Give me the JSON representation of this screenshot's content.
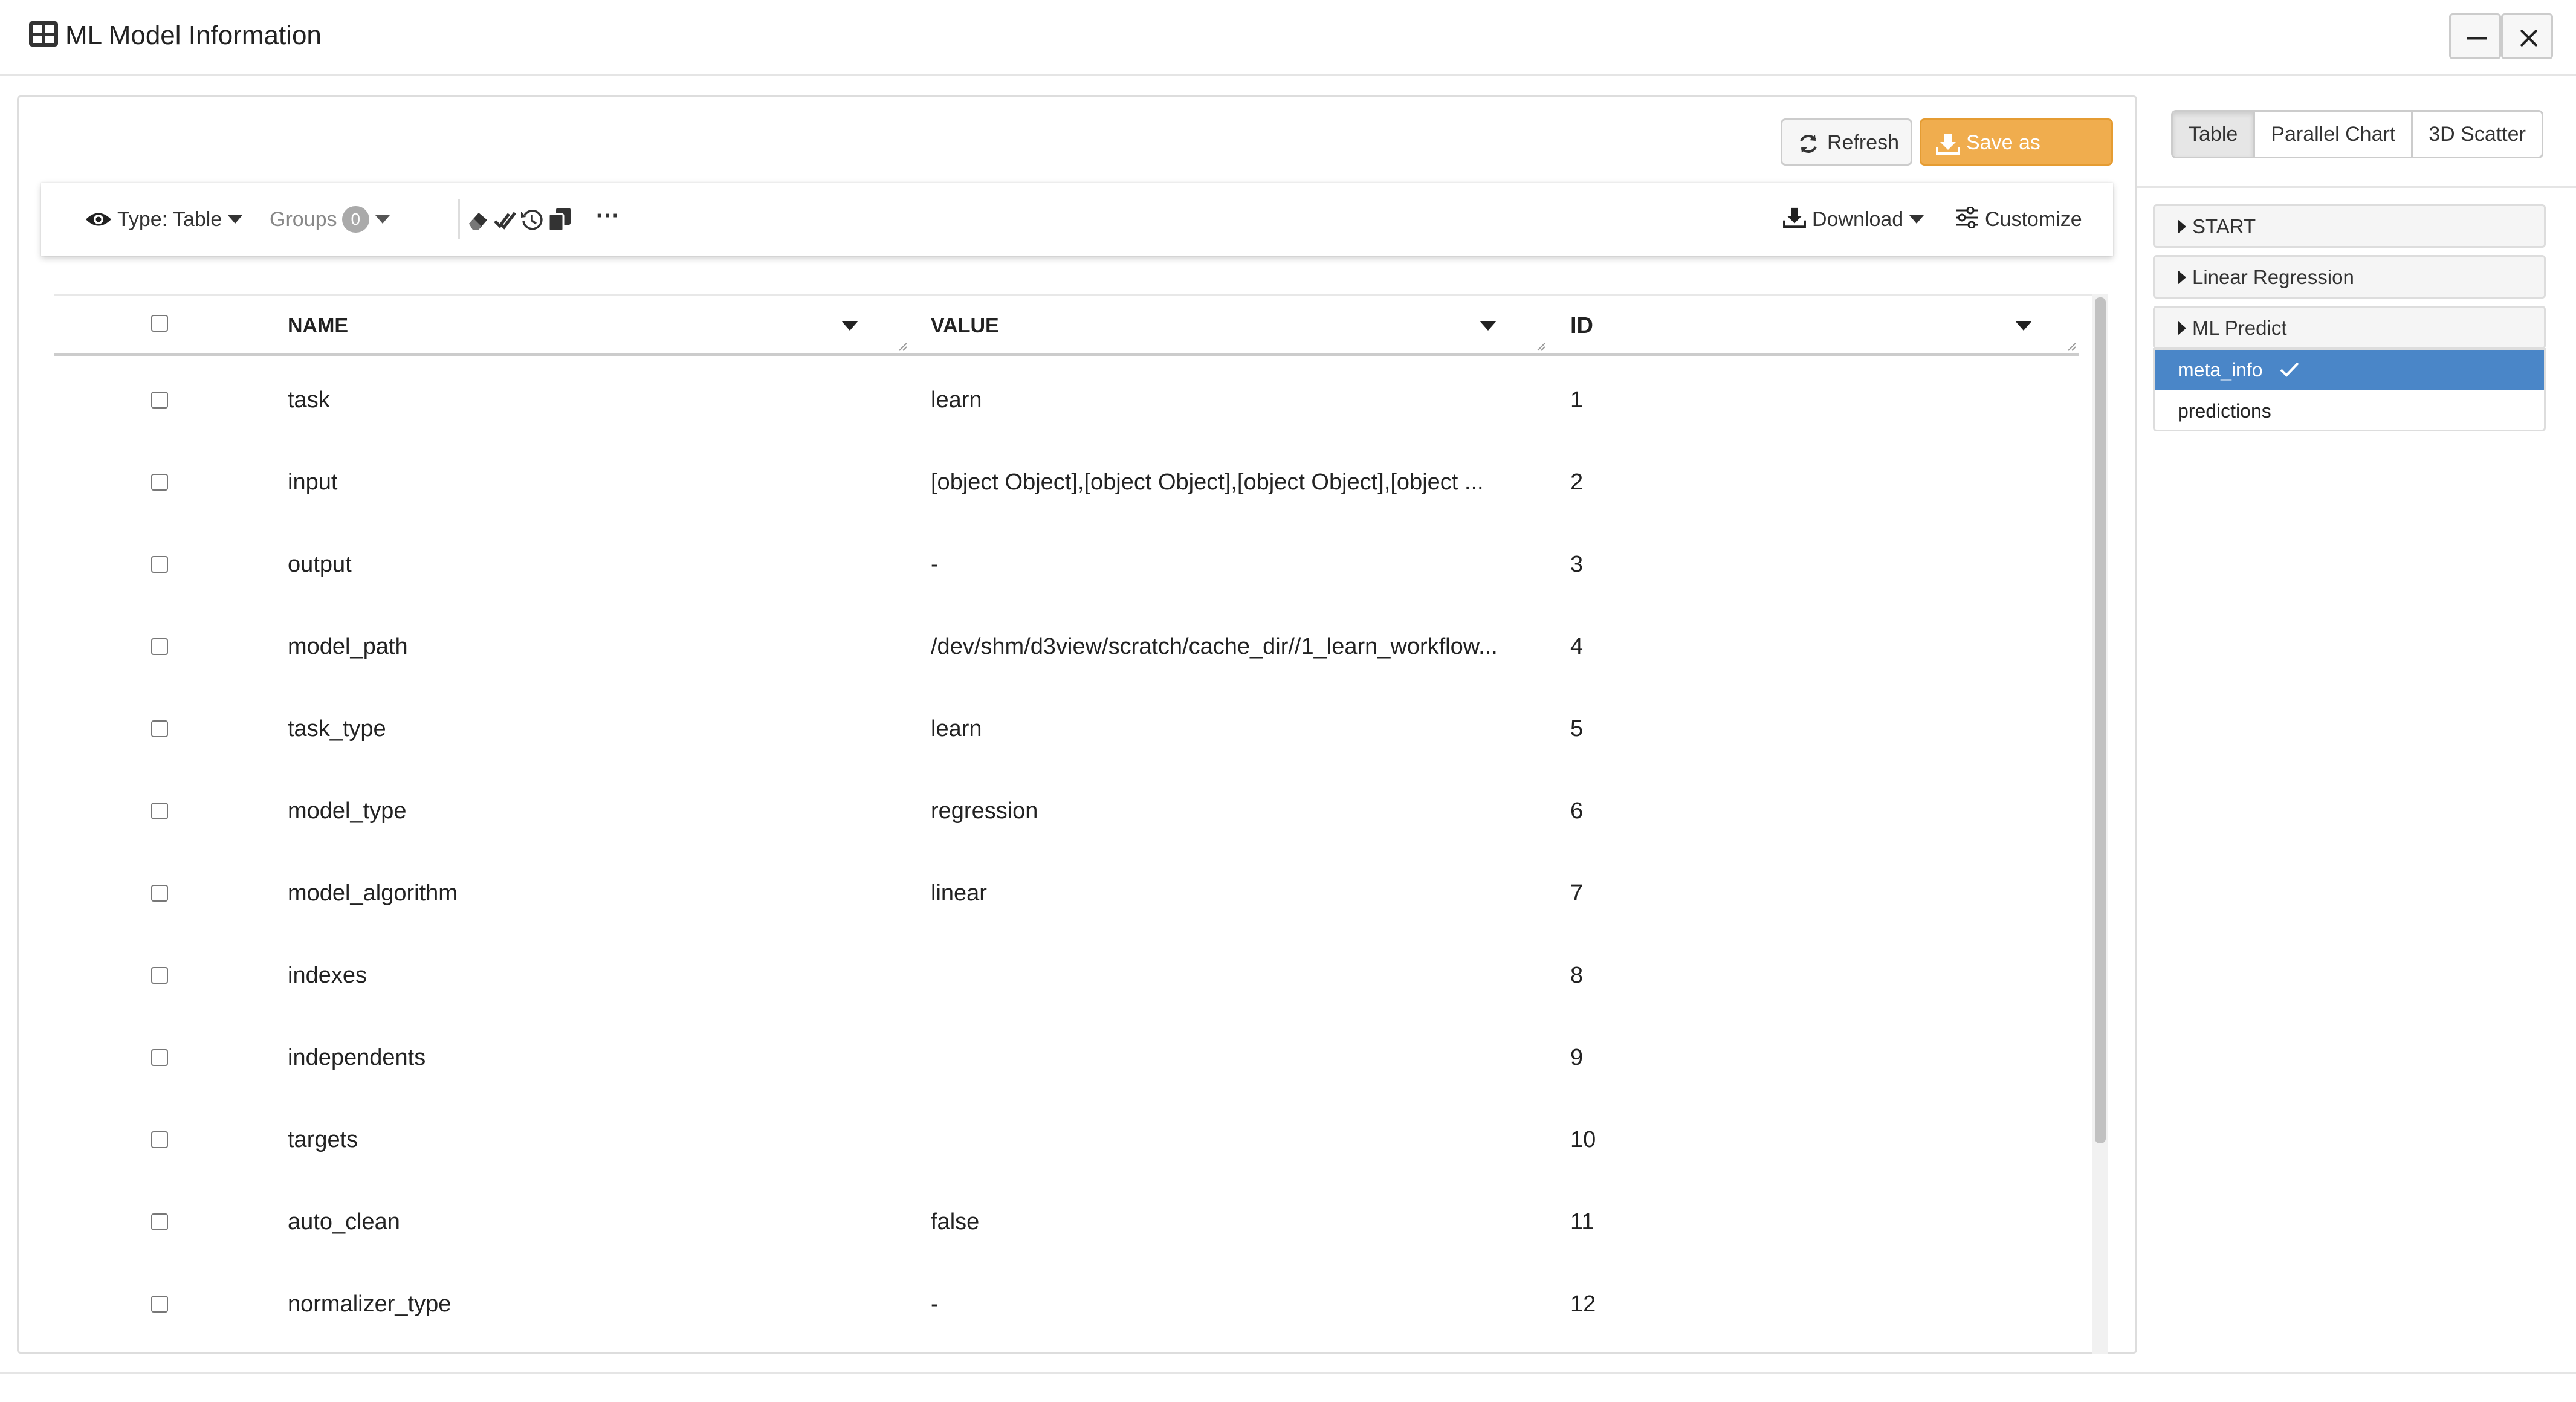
{
  "window": {
    "title": "ML Model Information",
    "minimize_label": "Minimize",
    "close_label": "Close"
  },
  "actions": {
    "refresh": "Refresh",
    "save_image": "Save as Image"
  },
  "toolbar": {
    "type_label": "Type: Table",
    "groups_label": "Groups",
    "groups_count": "0",
    "more_label": "···",
    "download_label": "Download",
    "customize_label": "Customize",
    "icons": [
      "eye-icon",
      "eraser-icon",
      "check-all-icon",
      "history-icon",
      "copy-icon",
      "ellipsis-icon",
      "download-icon",
      "sliders-icon"
    ]
  },
  "table": {
    "columns": [
      "NAME",
      "VALUE",
      "ID"
    ],
    "rows": [
      {
        "name": "task",
        "value": "learn",
        "id": "1"
      },
      {
        "name": "input",
        "value": "[object Object],[object Object],[object Object],[object ...",
        "id": "2"
      },
      {
        "name": "output",
        "value": "-",
        "id": "3"
      },
      {
        "name": "model_path",
        "value": "/dev/shm/d3view/scratch/cache_dir//1_learn_workflow...",
        "id": "4"
      },
      {
        "name": "task_type",
        "value": "learn",
        "id": "5"
      },
      {
        "name": "model_type",
        "value": "regression",
        "id": "6"
      },
      {
        "name": "model_algorithm",
        "value": "linear",
        "id": "7"
      },
      {
        "name": "indexes",
        "value": "",
        "id": "8"
      },
      {
        "name": "independents",
        "value": "",
        "id": "9"
      },
      {
        "name": "targets",
        "value": "",
        "id": "10"
      },
      {
        "name": "auto_clean",
        "value": "false",
        "id": "11"
      },
      {
        "name": "normalizer_type",
        "value": "-",
        "id": "12"
      }
    ]
  },
  "view_tabs": {
    "tabs": [
      "Table",
      "Parallel Chart",
      "3D Scatter"
    ],
    "active": "Table"
  },
  "sidebar": {
    "sections": [
      "START",
      "Linear Regression",
      "ML Predict"
    ],
    "items": [
      {
        "label": "meta_info",
        "selected": true
      },
      {
        "label": "predictions",
        "selected": false
      }
    ]
  },
  "colors": {
    "accent_orange": "#f0ad4e",
    "selected_blue": "#4a86c8"
  }
}
